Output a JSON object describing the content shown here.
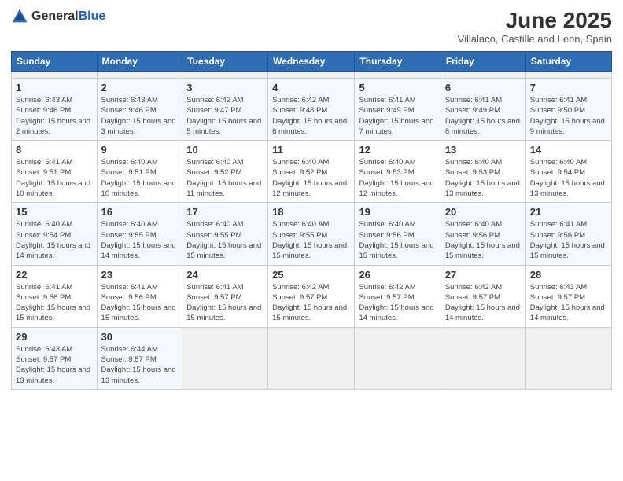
{
  "header": {
    "logo_general": "General",
    "logo_blue": "Blue",
    "title": "June 2025",
    "location": "Villalaco, Castille and Leon, Spain"
  },
  "calendar": {
    "weekdays": [
      "Sunday",
      "Monday",
      "Tuesday",
      "Wednesday",
      "Thursday",
      "Friday",
      "Saturday"
    ],
    "weeks": [
      [
        {
          "day": "",
          "empty": true
        },
        {
          "day": "",
          "empty": true
        },
        {
          "day": "",
          "empty": true
        },
        {
          "day": "",
          "empty": true
        },
        {
          "day": "",
          "empty": true
        },
        {
          "day": "",
          "empty": true
        },
        {
          "day": "",
          "empty": true
        }
      ],
      [
        {
          "day": "1",
          "sunrise": "Sunrise: 6:43 AM",
          "sunset": "Sunset: 9:46 PM",
          "daylight": "Daylight: 15 hours and 2 minutes."
        },
        {
          "day": "2",
          "sunrise": "Sunrise: 6:43 AM",
          "sunset": "Sunset: 9:46 PM",
          "daylight": "Daylight: 15 hours and 3 minutes."
        },
        {
          "day": "3",
          "sunrise": "Sunrise: 6:42 AM",
          "sunset": "Sunset: 9:47 PM",
          "daylight": "Daylight: 15 hours and 5 minutes."
        },
        {
          "day": "4",
          "sunrise": "Sunrise: 6:42 AM",
          "sunset": "Sunset: 9:48 PM",
          "daylight": "Daylight: 15 hours and 6 minutes."
        },
        {
          "day": "5",
          "sunrise": "Sunrise: 6:41 AM",
          "sunset": "Sunset: 9:49 PM",
          "daylight": "Daylight: 15 hours and 7 minutes."
        },
        {
          "day": "6",
          "sunrise": "Sunrise: 6:41 AM",
          "sunset": "Sunset: 9:49 PM",
          "daylight": "Daylight: 15 hours and 8 minutes."
        },
        {
          "day": "7",
          "sunrise": "Sunrise: 6:41 AM",
          "sunset": "Sunset: 9:50 PM",
          "daylight": "Daylight: 15 hours and 9 minutes."
        }
      ],
      [
        {
          "day": "8",
          "sunrise": "Sunrise: 6:41 AM",
          "sunset": "Sunset: 9:51 PM",
          "daylight": "Daylight: 15 hours and 10 minutes."
        },
        {
          "day": "9",
          "sunrise": "Sunrise: 6:40 AM",
          "sunset": "Sunset: 9:51 PM",
          "daylight": "Daylight: 15 hours and 10 minutes."
        },
        {
          "day": "10",
          "sunrise": "Sunrise: 6:40 AM",
          "sunset": "Sunset: 9:52 PM",
          "daylight": "Daylight: 15 hours and 11 minutes."
        },
        {
          "day": "11",
          "sunrise": "Sunrise: 6:40 AM",
          "sunset": "Sunset: 9:52 PM",
          "daylight": "Daylight: 15 hours and 12 minutes."
        },
        {
          "day": "12",
          "sunrise": "Sunrise: 6:40 AM",
          "sunset": "Sunset: 9:53 PM",
          "daylight": "Daylight: 15 hours and 12 minutes."
        },
        {
          "day": "13",
          "sunrise": "Sunrise: 6:40 AM",
          "sunset": "Sunset: 9:53 PM",
          "daylight": "Daylight: 15 hours and 13 minutes."
        },
        {
          "day": "14",
          "sunrise": "Sunrise: 6:40 AM",
          "sunset": "Sunset: 9:54 PM",
          "daylight": "Daylight: 15 hours and 13 minutes."
        }
      ],
      [
        {
          "day": "15",
          "sunrise": "Sunrise: 6:40 AM",
          "sunset": "Sunset: 9:54 PM",
          "daylight": "Daylight: 15 hours and 14 minutes."
        },
        {
          "day": "16",
          "sunrise": "Sunrise: 6:40 AM",
          "sunset": "Sunset: 9:55 PM",
          "daylight": "Daylight: 15 hours and 14 minutes."
        },
        {
          "day": "17",
          "sunrise": "Sunrise: 6:40 AM",
          "sunset": "Sunset: 9:55 PM",
          "daylight": "Daylight: 15 hours and 15 minutes."
        },
        {
          "day": "18",
          "sunrise": "Sunrise: 6:40 AM",
          "sunset": "Sunset: 9:55 PM",
          "daylight": "Daylight: 15 hours and 15 minutes."
        },
        {
          "day": "19",
          "sunrise": "Sunrise: 6:40 AM",
          "sunset": "Sunset: 9:56 PM",
          "daylight": "Daylight: 15 hours and 15 minutes."
        },
        {
          "day": "20",
          "sunrise": "Sunrise: 6:40 AM",
          "sunset": "Sunset: 9:56 PM",
          "daylight": "Daylight: 15 hours and 15 minutes."
        },
        {
          "day": "21",
          "sunrise": "Sunrise: 6:41 AM",
          "sunset": "Sunset: 9:56 PM",
          "daylight": "Daylight: 15 hours and 15 minutes."
        }
      ],
      [
        {
          "day": "22",
          "sunrise": "Sunrise: 6:41 AM",
          "sunset": "Sunset: 9:56 PM",
          "daylight": "Daylight: 15 hours and 15 minutes."
        },
        {
          "day": "23",
          "sunrise": "Sunrise: 6:41 AM",
          "sunset": "Sunset: 9:56 PM",
          "daylight": "Daylight: 15 hours and 15 minutes."
        },
        {
          "day": "24",
          "sunrise": "Sunrise: 6:41 AM",
          "sunset": "Sunset: 9:57 PM",
          "daylight": "Daylight: 15 hours and 15 minutes."
        },
        {
          "day": "25",
          "sunrise": "Sunrise: 6:42 AM",
          "sunset": "Sunset: 9:57 PM",
          "daylight": "Daylight: 15 hours and 15 minutes."
        },
        {
          "day": "26",
          "sunrise": "Sunrise: 6:42 AM",
          "sunset": "Sunset: 9:57 PM",
          "daylight": "Daylight: 15 hours and 14 minutes."
        },
        {
          "day": "27",
          "sunrise": "Sunrise: 6:42 AM",
          "sunset": "Sunset: 9:57 PM",
          "daylight": "Daylight: 15 hours and 14 minutes."
        },
        {
          "day": "28",
          "sunrise": "Sunrise: 6:43 AM",
          "sunset": "Sunset: 9:57 PM",
          "daylight": "Daylight: 15 hours and 14 minutes."
        }
      ],
      [
        {
          "day": "29",
          "sunrise": "Sunrise: 6:43 AM",
          "sunset": "Sunset: 9:57 PM",
          "daylight": "Daylight: 15 hours and 13 minutes."
        },
        {
          "day": "30",
          "sunrise": "Sunrise: 6:44 AM",
          "sunset": "Sunset: 9:57 PM",
          "daylight": "Daylight: 15 hours and 13 minutes."
        },
        {
          "day": "",
          "empty": true
        },
        {
          "day": "",
          "empty": true
        },
        {
          "day": "",
          "empty": true
        },
        {
          "day": "",
          "empty": true
        },
        {
          "day": "",
          "empty": true
        }
      ]
    ]
  }
}
